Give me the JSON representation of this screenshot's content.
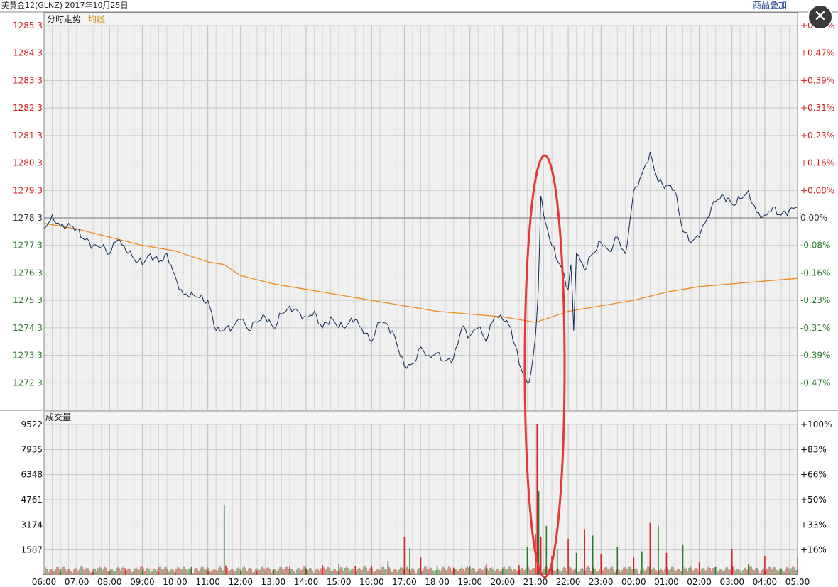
{
  "header": {
    "title": "美黄金12(GLNZ) 2017年10月25日",
    "overlay_label": "商品叠加",
    "close_glyph": "✕"
  },
  "price_panel": {
    "label": "分时走势",
    "avg_label": "均线"
  },
  "volume_panel": {
    "label": "成交量"
  },
  "colors": {
    "price_line": "#0d2a55",
    "avg_line": "#f08a1c",
    "up": "#d42020",
    "down": "#2a7a2a",
    "annotation": "#e53935",
    "grid": "#c6c6c6"
  },
  "chart_data": [
    {
      "type": "line",
      "title": "分时走势",
      "x_ticks": [
        "06:00",
        "07:00",
        "08:00",
        "09:00",
        "10:00",
        "11:00",
        "12:00",
        "13:00",
        "14:00",
        "15:00",
        "16:00",
        "17:00",
        "18:00",
        "19:00",
        "20:00",
        "21:00",
        "22:00",
        "23:00",
        "00:00",
        "01:00",
        "02:00",
        "03:00",
        "04:00",
        "05:00"
      ],
      "y_ticks": [
        "1285.3",
        "1284.3",
        "1283.3",
        "1282.3",
        "1281.3",
        "1280.3",
        "1279.3",
        "1278.3",
        "1277.3",
        "1276.3",
        "1275.3",
        "1274.3",
        "1273.3",
        "1272.3"
      ],
      "y_ticks_right": [
        "+0.55%",
        "+0.47%",
        "+0.39%",
        "+0.31%",
        "+0.23%",
        "+0.16%",
        "+0.08%",
        "0.00%",
        "-0.08%",
        "-0.16%",
        "-0.23%",
        "-0.31%",
        "-0.39%",
        "-0.47%"
      ],
      "ylim": [
        1271.3,
        1285.3
      ],
      "reference_price": 1278.3,
      "series": [
        {
          "name": "分时走势",
          "x": [
            "06:00",
            "06:15",
            "06:30",
            "06:45",
            "07:00",
            "07:15",
            "07:30",
            "07:45",
            "08:00",
            "08:15",
            "08:30",
            "08:45",
            "09:00",
            "09:15",
            "09:30",
            "09:45",
            "10:00",
            "10:15",
            "10:30",
            "10:45",
            "11:00",
            "11:15",
            "11:30",
            "11:45",
            "12:00",
            "12:15",
            "12:30",
            "12:45",
            "13:00",
            "13:15",
            "13:30",
            "13:45",
            "14:00",
            "14:15",
            "14:30",
            "14:45",
            "15:00",
            "15:15",
            "15:30",
            "15:45",
            "16:00",
            "16:15",
            "16:30",
            "16:45",
            "17:00",
            "17:15",
            "17:30",
            "17:45",
            "18:00",
            "18:15",
            "18:30",
            "18:45",
            "19:00",
            "19:15",
            "19:30",
            "19:45",
            "20:00",
            "20:15",
            "20:30",
            "20:45",
            "20:52",
            "21:00",
            "21:05",
            "21:10",
            "21:15",
            "21:30",
            "21:45",
            "22:00",
            "22:05",
            "22:10",
            "22:15",
            "22:30",
            "22:45",
            "23:00",
            "23:15",
            "23:30",
            "23:45",
            "00:00",
            "00:15",
            "00:30",
            "00:45",
            "01:00",
            "01:15",
            "01:30",
            "01:45",
            "02:00",
            "02:15",
            "02:30",
            "02:45",
            "03:00",
            "03:15",
            "03:30",
            "03:45",
            "04:00",
            "04:15",
            "04:30",
            "04:45",
            "05:00"
          ],
          "values": [
            1277.9,
            1278.4,
            1278.0,
            1278.1,
            1277.9,
            1277.5,
            1277.3,
            1277.2,
            1277.0,
            1277.5,
            1277.1,
            1276.8,
            1276.6,
            1277.0,
            1276.7,
            1277.0,
            1276.2,
            1275.5,
            1275.6,
            1275.4,
            1275.3,
            1274.2,
            1274.2,
            1274.3,
            1274.6,
            1274.2,
            1274.5,
            1274.7,
            1274.3,
            1274.8,
            1275.1,
            1274.9,
            1274.7,
            1274.9,
            1274.3,
            1274.7,
            1274.3,
            1274.4,
            1274.6,
            1274.1,
            1273.8,
            1274.5,
            1274.4,
            1273.8,
            1272.9,
            1273.0,
            1273.6,
            1273.3,
            1273.4,
            1273.1,
            1273.2,
            1274.3,
            1274.0,
            1274.3,
            1273.8,
            1274.7,
            1274.6,
            1274.3,
            1273.0,
            1272.3,
            1272.7,
            1274.0,
            1275.6,
            1279.1,
            1278.4,
            1277.3,
            1276.6,
            1275.7,
            1276.6,
            1274.2,
            1277.0,
            1276.4,
            1277.0,
            1277.4,
            1277.1,
            1277.6,
            1277.0,
            1279.3,
            1279.9,
            1280.7,
            1279.6,
            1279.5,
            1279.3,
            1277.8,
            1277.4,
            1277.6,
            1278.3,
            1278.9,
            1279.1,
            1278.8,
            1279.0,
            1279.3,
            1278.5,
            1278.4,
            1278.7,
            1278.4,
            1278.6,
            1278.7
          ]
        },
        {
          "name": "均线",
          "x": [
            "06:00",
            "07:00",
            "08:00",
            "09:00",
            "10:00",
            "11:00",
            "11:30",
            "12:00",
            "13:00",
            "14:00",
            "15:00",
            "16:00",
            "17:00",
            "18:00",
            "19:00",
            "20:00",
            "21:00",
            "21:30",
            "22:00",
            "23:00",
            "00:00",
            "01:00",
            "02:00",
            "03:00",
            "04:00",
            "05:00"
          ],
          "values": [
            1278.1,
            1277.9,
            1277.6,
            1277.3,
            1277.1,
            1276.7,
            1276.6,
            1276.2,
            1275.9,
            1275.7,
            1275.5,
            1275.3,
            1275.1,
            1274.9,
            1274.8,
            1274.7,
            1274.5,
            1274.7,
            1274.9,
            1275.1,
            1275.3,
            1275.6,
            1275.8,
            1275.9,
            1276.0,
            1276.1
          ]
        }
      ]
    },
    {
      "type": "bar",
      "title": "成交量",
      "y_ticks": [
        "9522",
        "7935",
        "6348",
        "4761",
        "3174",
        "1587"
      ],
      "y_ticks_right": [
        "+100%",
        "+83%",
        "+66%",
        "+50%",
        "+33%",
        "+16%"
      ],
      "ylim": [
        0,
        9522
      ],
      "x": [
        "06:00",
        "06:30",
        "07:00",
        "07:30",
        "08:00",
        "08:30",
        "09:00",
        "09:30",
        "10:00",
        "10:30",
        "11:00",
        "11:30",
        "11:33",
        "12:00",
        "12:30",
        "13:00",
        "13:30",
        "14:00",
        "14:30",
        "15:00",
        "15:30",
        "16:00",
        "16:30",
        "17:00",
        "17:10",
        "17:30",
        "18:00",
        "18:30",
        "19:00",
        "19:30",
        "20:00",
        "20:30",
        "20:45",
        "21:00",
        "21:03",
        "21:06",
        "21:10",
        "21:20",
        "21:30",
        "21:40",
        "22:00",
        "22:15",
        "22:30",
        "22:45",
        "23:00",
        "23:30",
        "00:00",
        "00:15",
        "00:30",
        "00:45",
        "01:00",
        "01:30",
        "02:00",
        "02:30",
        "03:00",
        "03:30",
        "04:00",
        "04:30",
        "05:00"
      ],
      "values": [
        120,
        200,
        90,
        160,
        260,
        310,
        240,
        180,
        150,
        500,
        210,
        4450,
        600,
        210,
        240,
        300,
        520,
        420,
        620,
        690,
        540,
        580,
        880,
        2400,
        1700,
        1100,
        600,
        460,
        520,
        700,
        380,
        620,
        1800,
        2600,
        9522,
        5300,
        2400,
        3100,
        1200,
        1600,
        2300,
        1400,
        2900,
        2500,
        1300,
        1800,
        1100,
        1500,
        3300,
        3100,
        1400,
        1900,
        800,
        500,
        1650,
        700,
        1200,
        420,
        1100
      ],
      "up": [
        true,
        false,
        true,
        true,
        false,
        true,
        false,
        true,
        true,
        false,
        true,
        false,
        true,
        false,
        true,
        false,
        true,
        false,
        true,
        false,
        true,
        true,
        false,
        true,
        false,
        true,
        false,
        true,
        false,
        true,
        false,
        true,
        false,
        true,
        true,
        false,
        true,
        false,
        true,
        false,
        true,
        false,
        true,
        false,
        true,
        false,
        true,
        false,
        true,
        false,
        true,
        false,
        true,
        false,
        true,
        false,
        true,
        false,
        true
      ]
    }
  ]
}
